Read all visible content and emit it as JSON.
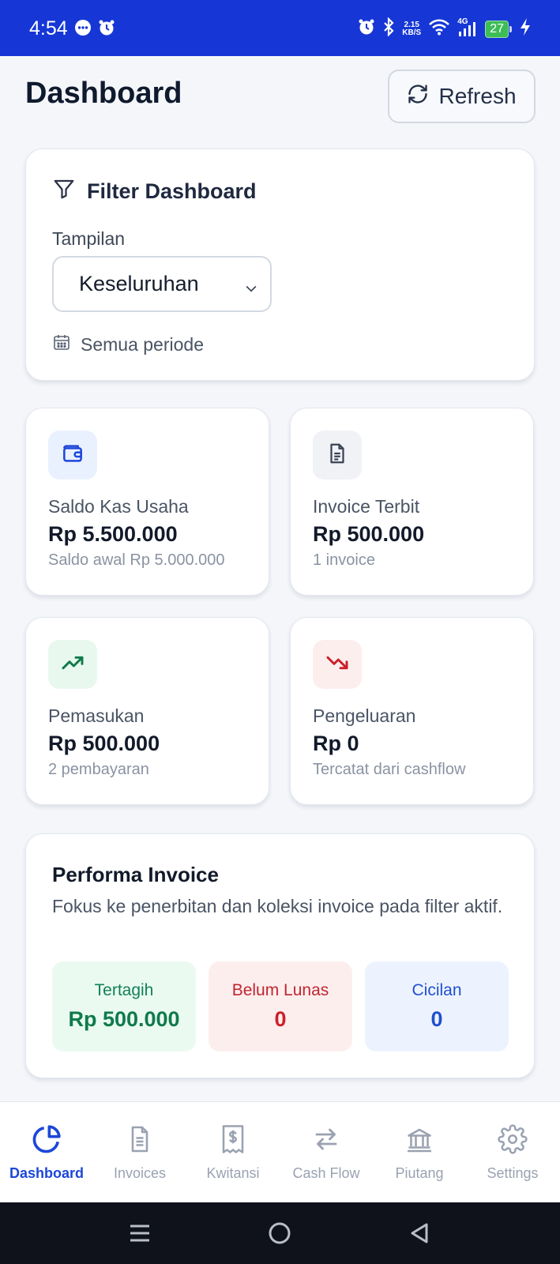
{
  "status_bar": {
    "time": "4:54",
    "net_speed_value": "2.15",
    "net_speed_unit": "KB/S",
    "network_type": "4G",
    "battery": "27"
  },
  "header": {
    "title": "Dashboard",
    "refresh_label": "Refresh"
  },
  "filter": {
    "title": "Filter Dashboard",
    "view_label": "Tampilan",
    "view_selected": "Keseluruhan",
    "period_text": "Semua periode"
  },
  "stats": [
    {
      "label": "Saldo Kas Usaha",
      "value": "Rp 5.500.000",
      "note": "Saldo awal Rp 5.000.000",
      "icon": "wallet-icon"
    },
    {
      "label": "Invoice Terbit",
      "value": "Rp 500.000",
      "note": "1 invoice",
      "icon": "document-icon"
    },
    {
      "label": "Pemasukan",
      "value": "Rp 500.000",
      "note": "2 pembayaran",
      "icon": "trending-up-icon"
    },
    {
      "label": "Pengeluaran",
      "value": "Rp 0",
      "note": "Tercatat dari cashflow",
      "icon": "trending-down-icon"
    }
  ],
  "performance": {
    "title": "Performa Invoice",
    "description": "Fokus ke penerbitan dan koleksi invoice pada filter aktif.",
    "boxes": [
      {
        "label": "Tertagih",
        "value": "Rp 500.000"
      },
      {
        "label": "Belum Lunas",
        "value": "0"
      },
      {
        "label": "Cicilan",
        "value": "0"
      }
    ]
  },
  "nav": {
    "items": [
      {
        "label": "Dashboard",
        "icon": "pie-chart-icon",
        "active": true
      },
      {
        "label": "Invoices",
        "icon": "file-icon"
      },
      {
        "label": "Kwitansi",
        "icon": "receipt-icon"
      },
      {
        "label": "Cash Flow",
        "icon": "arrows-icon"
      },
      {
        "label": "Piutang",
        "icon": "bank-icon"
      },
      {
        "label": "Settings",
        "icon": "gear-icon"
      }
    ]
  },
  "colors": {
    "primary": "#1d47d8",
    "status_bar": "#1637d6",
    "success": "#0f7a4a",
    "danger": "#cc1f2a",
    "info": "#1f4fd0"
  }
}
